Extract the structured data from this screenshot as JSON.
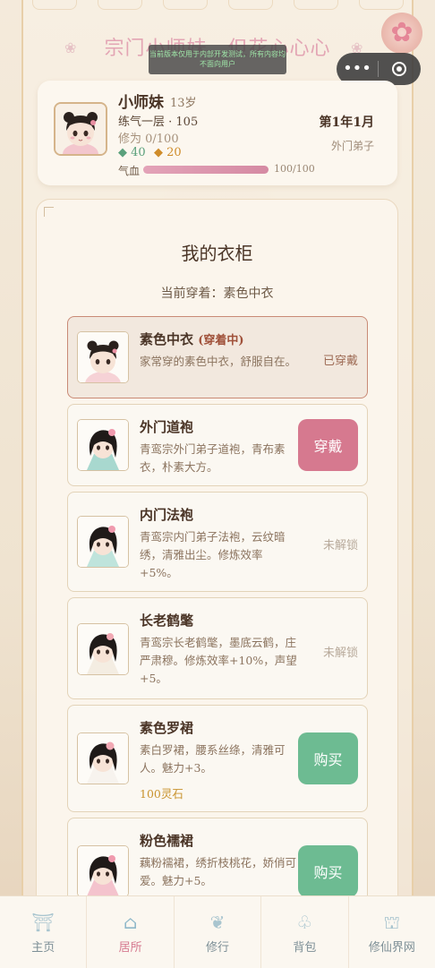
{
  "header": {
    "title": "宗门小师妹，但花心心心",
    "notice": "当前版本仅用于内部开发测试，所有内容均不面向用户",
    "capsule_more": "•••"
  },
  "profile": {
    "name": "小师妹",
    "age": "13岁",
    "realm": "练气一层 · 105",
    "cultivation": "修为 0/100",
    "stat_green": "40",
    "stat_gold": "20",
    "hp_label": "气血",
    "hp_value": "100/100",
    "hp_fraction": 1.0,
    "date": "第1年1月",
    "rank": "外门弟子"
  },
  "wardrobe": {
    "title": "我的衣柜",
    "current": "当前穿着：素色中衣",
    "items": [
      {
        "name": "素色中衣",
        "tag": "(穿着中)",
        "desc": "家常穿的素色中衣，舒服自在。",
        "price": "",
        "action": "已穿戴"
      },
      {
        "name": "外门道袍",
        "tag": "",
        "desc": "青鸾宗外门弟子道袍，青布素衣，朴素大方。",
        "price": "",
        "action": "穿戴"
      },
      {
        "name": "内门法袍",
        "tag": "",
        "desc": "青鸾宗内门弟子法袍，云纹暗绣，清雅出尘。修炼效率+5%。",
        "price": "",
        "action": "未解锁"
      },
      {
        "name": "长老鹤氅",
        "tag": "",
        "desc": "青鸾宗长老鹤氅，墨底云鹤，庄严肃穆。修炼效率+10%，声望+5。",
        "price": "",
        "action": "未解锁"
      },
      {
        "name": "素色罗裙",
        "tag": "",
        "desc": "素白罗裙，腰系丝绦，清雅可人。魅力+3。",
        "price": "100灵石",
        "action": "购买"
      },
      {
        "name": "粉色襦裙",
        "tag": "",
        "desc": "藕粉襦裙，绣折枝桃花，娇俏可爱。魅力+5。",
        "price": "",
        "action": "购买"
      }
    ]
  },
  "tabs": [
    {
      "label": "主页",
      "icon": "gate-icon"
    },
    {
      "label": "居所",
      "icon": "house-icon"
    },
    {
      "label": "修行",
      "icon": "lotus-icon"
    },
    {
      "label": "背包",
      "icon": "bag-icon"
    },
    {
      "label": "修仙界网",
      "icon": "pavilion-icon"
    }
  ],
  "colors": {
    "accent_pink": "#d6798f",
    "accent_green": "#6dbb92",
    "title_pink": "#e3a5b4"
  }
}
